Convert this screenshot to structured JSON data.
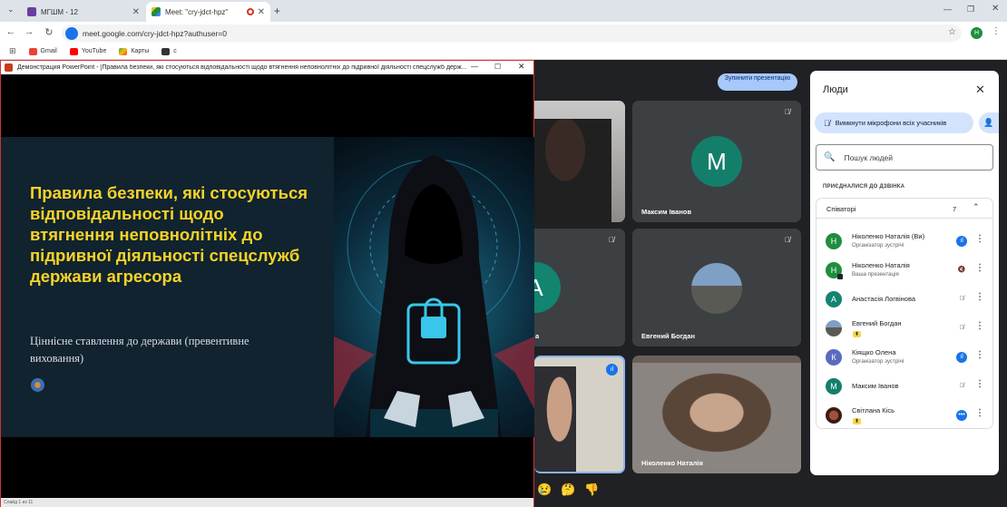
{
  "browser": {
    "tabs": [
      {
        "title": "МГШМ - 12",
        "favicon_color": "#6a3ea1"
      },
      {
        "title": "Meet: \"cry-jdct-hpz\"",
        "favicon_color": "#1e8e3e"
      }
    ],
    "url": "meet.google.com/cry-jdct-hpz?authuser=0",
    "profile_initial": "H",
    "bookmarks": [
      {
        "label": "Gmail",
        "icon": "gmail-icon"
      },
      {
        "label": "YouTube",
        "icon": "youtube-icon"
      },
      {
        "label": "Карты",
        "icon": "maps-icon"
      },
      {
        "label": "с",
        "icon": "bookmark-icon"
      }
    ]
  },
  "ppt": {
    "window_title": "Демонстрация PowerPoint - [Правила безпеки, які стосуються відповідальності щодо втягнення неповнолітніх до підривної діяльності спецслужб держ...",
    "slide_title": "Правила безпеки, які стосуються відповідальності щодо втягнення неповнолітніх до підривної діяльності спецслужб держави агресора",
    "slide_subtitle": "Ціннісне ставлення до держави (превентивне виховання)",
    "status": "Слайд 1 из 11"
  },
  "meet": {
    "stop_presenting": "Зупинити презентацію",
    "tiles": [
      {
        "name": "",
        "initial": ""
      },
      {
        "name": "Максим Іванов",
        "initial": "М",
        "color": "#137f6b"
      },
      {
        "name": "а",
        "initial": "А",
        "color": "#12846f"
      },
      {
        "name": "Евгений Богдан",
        "initial": ""
      },
      {
        "name": "",
        "initial": ""
      },
      {
        "name": "Ніколенко Наталія",
        "initial": ""
      }
    ],
    "reactions": [
      "😢",
      "🤔",
      "👎"
    ]
  },
  "people": {
    "title": "Люди",
    "mute_all": "Вимкнути мікрофони всіх учасників",
    "search_placeholder": "Пошук людей",
    "section": "ПРИЄДНАЛИСЯ ДО ДЗВІНКА",
    "group_label": "Співаторі",
    "group_count": "7",
    "participants": [
      {
        "name": "Ніколенко Наталія (Ви)",
        "role": "Організатор зустрічі",
        "initial": "Н",
        "color": "#1e8e3e",
        "mic": "active"
      },
      {
        "name": "Ніколенко Наталія",
        "role": "Ваша презентація",
        "initial": "Н",
        "color": "#1e8e3e",
        "mic": "muted"
      },
      {
        "name": "Анастасія Логвінова",
        "role": "",
        "initial": "А",
        "color": "#12846f",
        "mic": "muted"
      },
      {
        "name": "Евгений Богдан",
        "role": "",
        "initial": "",
        "color": "#8a8f95",
        "mic": "muted"
      },
      {
        "name": "Кіящко Олена",
        "role": "Організатор зустрічі",
        "initial": "К",
        "color": "#5a6bbf",
        "mic": "active"
      },
      {
        "name": "Максим Іванов",
        "role": "",
        "initial": "М",
        "color": "#137f6b",
        "mic": "muted"
      },
      {
        "name": "Світлана Кісь",
        "role": "",
        "initial": "",
        "color": "#5c2b1e",
        "mic": "dots"
      }
    ]
  }
}
